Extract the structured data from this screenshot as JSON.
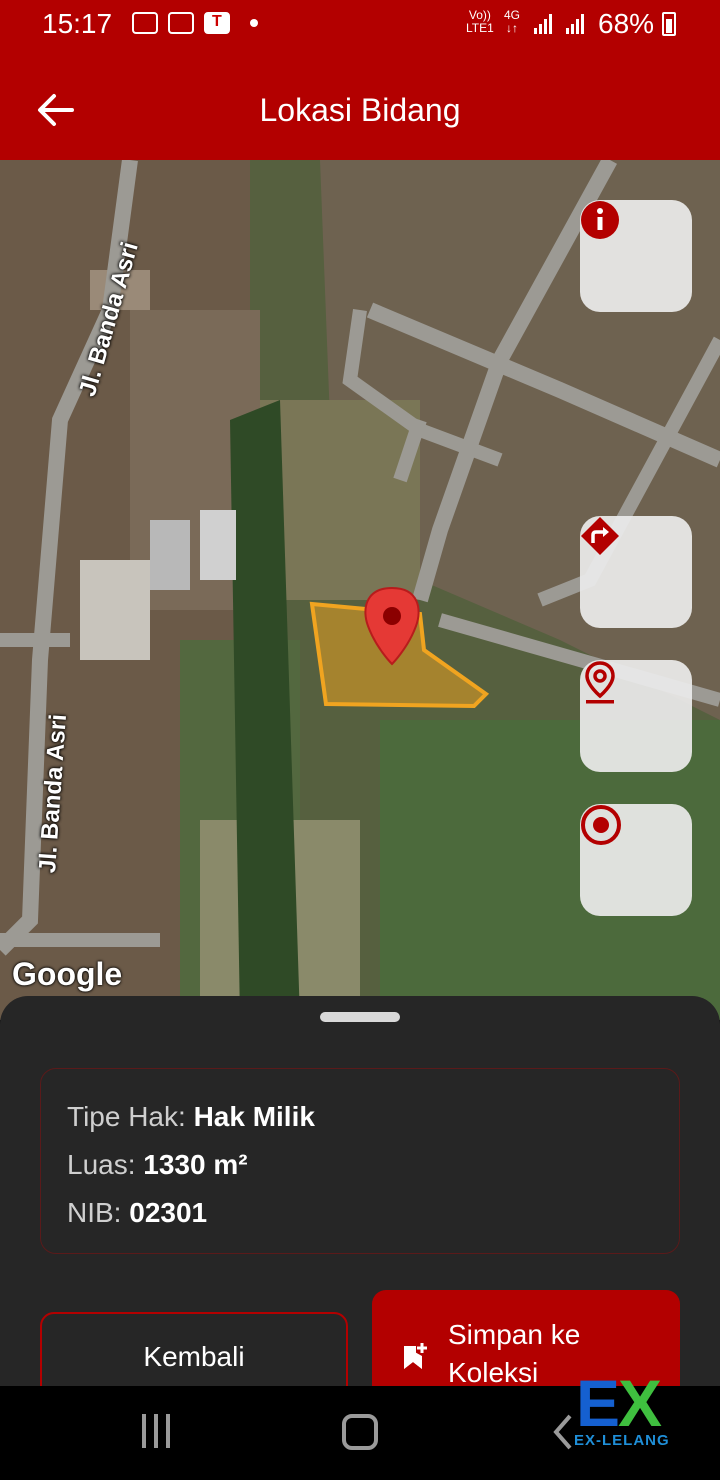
{
  "status_bar": {
    "time": "15:17",
    "net_top": "Vo))",
    "net_bottom": "LTE1",
    "gen_top": "4G",
    "gen_bottom": "↓↑",
    "battery": "68%"
  },
  "app_bar": {
    "title": "Lokasi Bidang"
  },
  "map": {
    "street_label_top": "Jl. Banda Asri",
    "street_label_bottom": "Jl. Banda Asri",
    "attribution": "Google",
    "parcel_color": "#e8a020"
  },
  "map_buttons": [
    {
      "name": "info",
      "icon": "info-icon"
    },
    {
      "name": "directions",
      "icon": "directions-icon"
    },
    {
      "name": "location",
      "icon": "location-pin-icon"
    },
    {
      "name": "my-location",
      "icon": "target-icon"
    }
  ],
  "parcel_info": {
    "type_label": "Tipe Hak:",
    "type_value": "Hak Milik",
    "area_label": "Luas:",
    "area_value": "1330 m²",
    "nib_label": "NIB:",
    "nib_value": "02301"
  },
  "actions": {
    "back_label": "Kembali",
    "save_label": "Simpan ke Koleksi"
  },
  "watermark": {
    "logo_e": "E",
    "logo_x": "X",
    "text": "EX-LELANG"
  },
  "colors": {
    "primary": "#b30000",
    "sheet_bg": "#262626"
  }
}
